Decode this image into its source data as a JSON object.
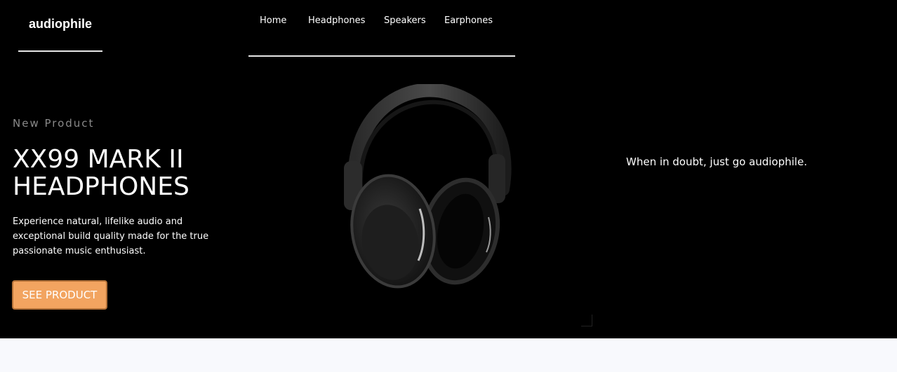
{
  "header": {
    "logo": "audiophile",
    "nav": [
      {
        "label": "Home"
      },
      {
        "label": "Headphones"
      },
      {
        "label": "Speakers"
      },
      {
        "label": "Earphones"
      }
    ]
  },
  "hero": {
    "eyebrow": "New Product",
    "title": "XX99 MARK II HEADPHONES",
    "description": "Experience natural, lifelike audio and exceptional build quality made for the true passionate music enthusiast.",
    "cta_label": "SEE PRODUCT",
    "tagline": "When in doubt, just go audiophile.",
    "product_image_icon": "headphones-image"
  },
  "colors": {
    "hero_background": "#000000",
    "accent": "#f2a460",
    "page_background": "#f8f9fd"
  }
}
